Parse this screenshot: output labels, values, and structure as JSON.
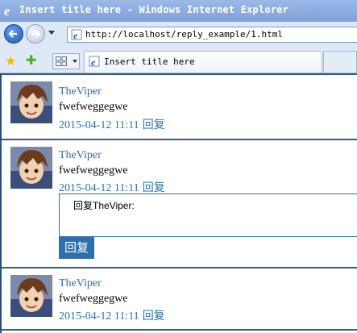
{
  "window": {
    "title": "Insert title here - Windows Internet Explorer"
  },
  "address": {
    "url": "http://localhost/reply_example/1.html"
  },
  "tab": {
    "label": "Insert title here"
  },
  "colors": {
    "link": "#2e6fab",
    "separator": "#2f5c8c",
    "button_bg": "#2e6fab"
  },
  "icons": {
    "browser": "ie-logo-icon",
    "back": "back-arrow-icon",
    "forward": "forward-arrow-icon",
    "favorites": "favorites-star-icon",
    "add_favorite": "add-favorite-icon",
    "quick_tabs": "quick-tabs-icon",
    "avatar": "user-avatar"
  },
  "comments": [
    {
      "username": "TheViper",
      "text": "fwefweggegwe",
      "date": "2015-04-12 11:11",
      "reply_label": "回复"
    },
    {
      "username": "TheViper",
      "text": "fwefweggegwe",
      "date": "2015-04-12 11:11",
      "reply_label": "回复"
    },
    {
      "username": "TheViper",
      "text": "fwefweggegwe",
      "date": "2015-04-12 11:11",
      "reply_label": "回复"
    }
  ],
  "reply_form": {
    "placeholder": "回复TheViper:",
    "submit_label": "回复"
  }
}
